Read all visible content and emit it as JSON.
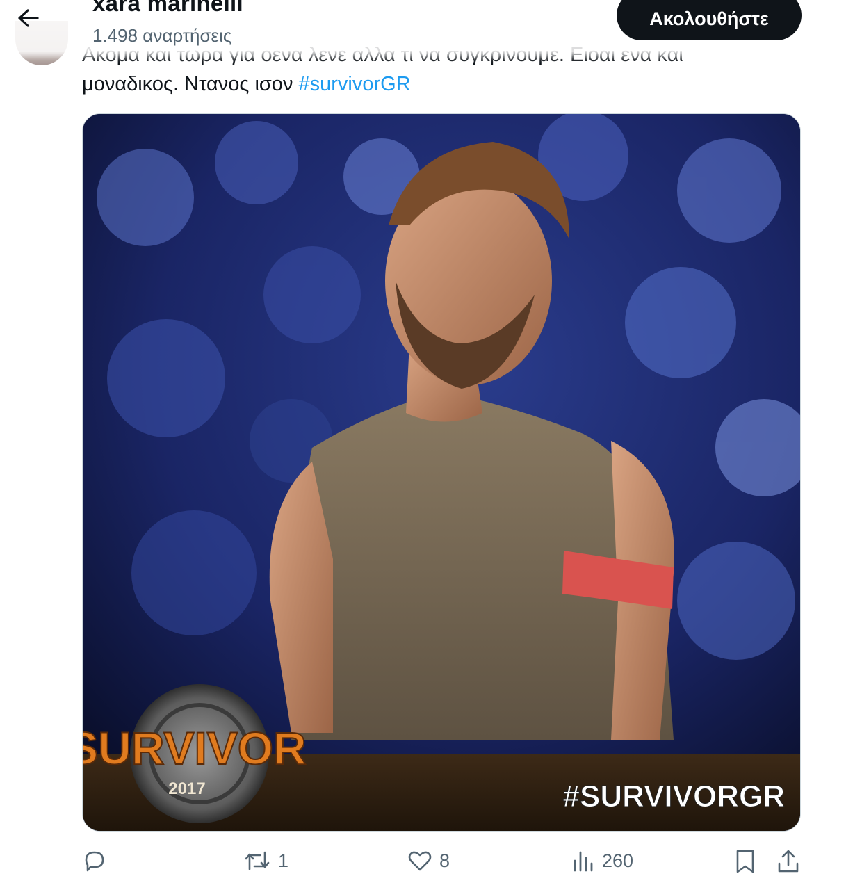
{
  "header": {
    "display_name": "xara marinelli",
    "post_count": "1.498 αναρτήσεις",
    "follow_label": "Ακολουθήστε"
  },
  "tweet": {
    "text_line1": "Ακομα και τωρα για οενα λενε αλλα τι να συγκρινουμε. Ειοαι ενα και",
    "text_line2_prefix": "μοναδικος. Ντανος ισον ",
    "hashtag": "#survivorGR"
  },
  "media": {
    "logo_word": "SURVIVOR",
    "logo_year": "2017",
    "overlay_hashtag": "#SURVIVORGR"
  },
  "actions": {
    "reply_count": "",
    "retweet_count": "1",
    "like_count": "8",
    "views_count": "260"
  },
  "colors": {
    "accent": "#1d9bf0",
    "text": "#0f1419",
    "muted": "#536471",
    "follow_bg": "#0f1419"
  },
  "icons": [
    "back-arrow-icon",
    "reply-icon",
    "retweet-icon",
    "like-icon",
    "views-icon",
    "bookmark-icon",
    "share-icon"
  ]
}
